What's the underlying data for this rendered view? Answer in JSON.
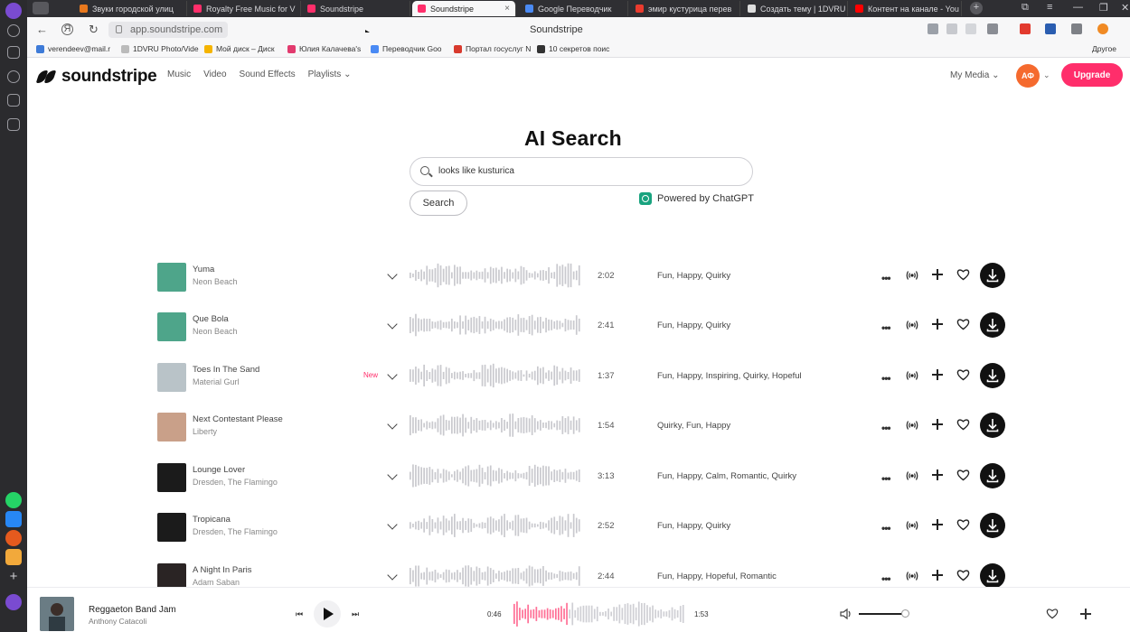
{
  "browser": {
    "tabs": [
      {
        "label": "Звуки городской улиц",
        "color": "#e8781d"
      },
      {
        "label": "Royalty Free Music for V",
        "color": "#ff2e6b"
      },
      {
        "label": "Soundstripe",
        "color": "#ff2e6b"
      },
      {
        "label": "Soundstripe",
        "color": "#ff2e6b",
        "active": true
      },
      {
        "label": "Google Переводчик",
        "color": "#4a8af4"
      },
      {
        "label": "эмир кустурица перев",
        "color": "#ea3b2e"
      },
      {
        "label": "Создать тему | 1DVRU F",
        "color": "#dddddd"
      },
      {
        "label": "Контент на канале - You",
        "color": "#ff0000"
      }
    ],
    "url": "app.soundstripe.com",
    "page_title": "Soundstripe",
    "bookmarks": [
      {
        "label": "verendeev@mail.r",
        "color": "#3e7bd8"
      },
      {
        "label": "1DVRU Photo/Vide",
        "color": "#bbbbbb"
      },
      {
        "label": "Мой диск – Диск",
        "color": "#f5b400"
      },
      {
        "label": "Юлия Калачева's",
        "color": "#e23a6e"
      },
      {
        "label": "Переводчик Goo",
        "color": "#4a8af4"
      },
      {
        "label": "Портал госуслуг N",
        "color": "#d83a2e"
      },
      {
        "label": "10 секретов поис",
        "color": "#333333"
      }
    ],
    "bookmarks_other": "Другое",
    "close_tab": "×"
  },
  "header": {
    "logo": "soundstripe",
    "nav": [
      "Music",
      "Video",
      "Sound Effects",
      "Playlists"
    ],
    "my_media": "My Media",
    "avatar_initials": "АФ",
    "upgrade": "Upgrade"
  },
  "search": {
    "title": "AI Search",
    "query": "looks like kusturica",
    "button": "Search",
    "powered_by": "Powered by ChatGPT"
  },
  "tracks": [
    {
      "title": "Yuma",
      "artist": "Neon Beach",
      "duration": "2:02",
      "tags": "Fun, Happy, Quirky",
      "new": false,
      "thumb": "#4ea58a"
    },
    {
      "title": "Que Bola",
      "artist": "Neon Beach",
      "duration": "2:41",
      "tags": "Fun, Happy, Quirky",
      "new": false,
      "thumb": "#4ea58a"
    },
    {
      "title": "Toes In The Sand",
      "artist": "Material Gurl",
      "duration": "1:37",
      "tags": "Fun, Happy, Inspiring, Quirky, Hopeful",
      "new": true,
      "thumb": "#b9c3c8"
    },
    {
      "title": "Next Contestant Please",
      "artist": "Liberty",
      "duration": "1:54",
      "tags": "Quirky, Fun, Happy",
      "new": false,
      "thumb": "#c9a089"
    },
    {
      "title": "Lounge Lover",
      "artist": "Dresden, The Flamingo",
      "duration": "3:13",
      "tags": "Fun, Happy, Calm, Romantic, Quirky",
      "new": false,
      "thumb": "#1b1b1b"
    },
    {
      "title": "Tropicana",
      "artist": "Dresden, The Flamingo",
      "duration": "2:52",
      "tags": "Fun, Happy, Quirky",
      "new": false,
      "thumb": "#1b1b1b"
    },
    {
      "title": "A Night In Paris",
      "artist": "Adam Saban",
      "duration": "2:44",
      "tags": "Fun, Happy, Hopeful, Romantic",
      "new": false,
      "thumb": "#2a2424"
    }
  ],
  "new_label": "New",
  "player": {
    "title": "Reggaeton Band Jam",
    "artist": "Anthony Catacoli",
    "current": "0:46",
    "total": "1:53",
    "progress": 0.32,
    "volume": 0.98
  },
  "help": "?",
  "colors": {
    "accent": "#ff2e6b",
    "chatgpt": "#19a37f",
    "avatar": "#f56a2e"
  }
}
